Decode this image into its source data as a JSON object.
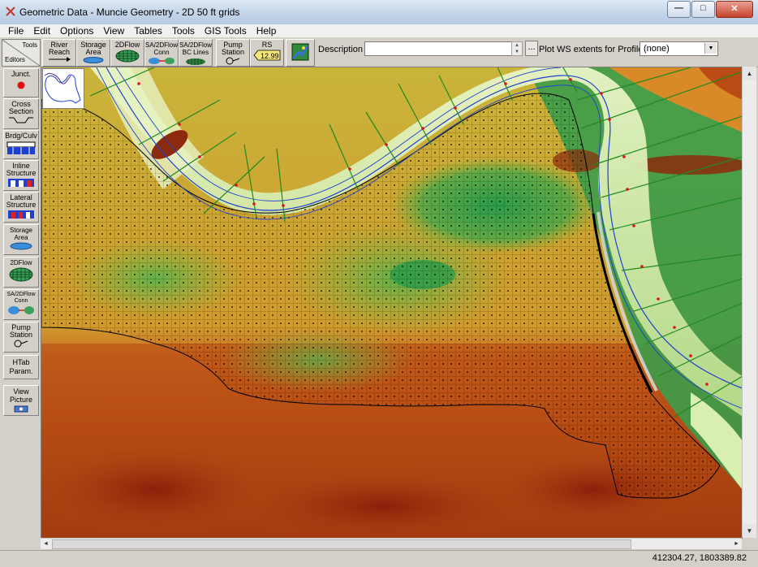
{
  "window": {
    "title": "Geometric Data - Muncie Geometry - 2D 50 ft grids",
    "minimize_glyph": "—",
    "maximize_glyph": "□",
    "close_glyph": "✕"
  },
  "menu": [
    "File",
    "Edit",
    "Options",
    "View",
    "Tables",
    "Tools",
    "GIS Tools",
    "Help"
  ],
  "toolbar": {
    "tools_label": "Tools",
    "editors_label": "Editors",
    "buttons": [
      {
        "label": "River\nReach",
        "icon": "river-reach-icon"
      },
      {
        "label": "Storage\nArea",
        "icon": "storage-area-icon"
      },
      {
        "label": "2DFlow",
        "icon": "2dflow-grid-icon"
      },
      {
        "label": "SA/2DFlow\nConn",
        "icon": "sa-2dflow-conn-icon"
      },
      {
        "label": "SA/2DFlow\nBC Lines",
        "icon": "bc-lines-icon"
      },
      {
        "label": "Pump\nStation",
        "icon": "pump-station-icon"
      },
      {
        "label": "RS",
        "icon": "rs-tag-icon",
        "tag_value": "12.99"
      },
      {
        "label": "",
        "icon": "map-background-icon"
      }
    ],
    "description_label": "Description :",
    "description_value": "",
    "more_button": "...",
    "plot_ws_label": "Plot WS extents for Profile:",
    "profile_selected": "(none)"
  },
  "palette": [
    {
      "label": "Junct.",
      "icon": "junction-icon"
    },
    {
      "label": "Cross\nSection",
      "icon": "cross-section-icon"
    },
    {
      "label": "Brdg/Culv",
      "icon": "bridge-culvert-icon"
    },
    {
      "label": "Inline\nStructure",
      "icon": "inline-structure-icon"
    },
    {
      "label": "Lateral\nStructure",
      "icon": "lateral-structure-icon"
    },
    {
      "label": "Storage\nArea",
      "icon": "storage-area-icon"
    },
    {
      "label": "2DFlow",
      "icon": "2dflow-grid-icon"
    },
    {
      "label": "SA/2DFlow\nConn",
      "icon": "sa-2dflow-conn-icon"
    },
    {
      "label": "Pump\nStation",
      "icon": "pump-station-icon"
    },
    {
      "label": "HTab\nParam.",
      "icon": ""
    },
    {
      "label": "View\nPicture",
      "icon": "view-picture-icon"
    }
  ],
  "status": {
    "coordinates": "412304.27, 1803389.82"
  },
  "colors": {
    "river_line": "#1f3fd0",
    "cross_section": "#1f8a1f",
    "mesh_boundary": "#000000",
    "terrain_high": "#8b2a0c",
    "terrain_low": "#2e9e4a"
  }
}
